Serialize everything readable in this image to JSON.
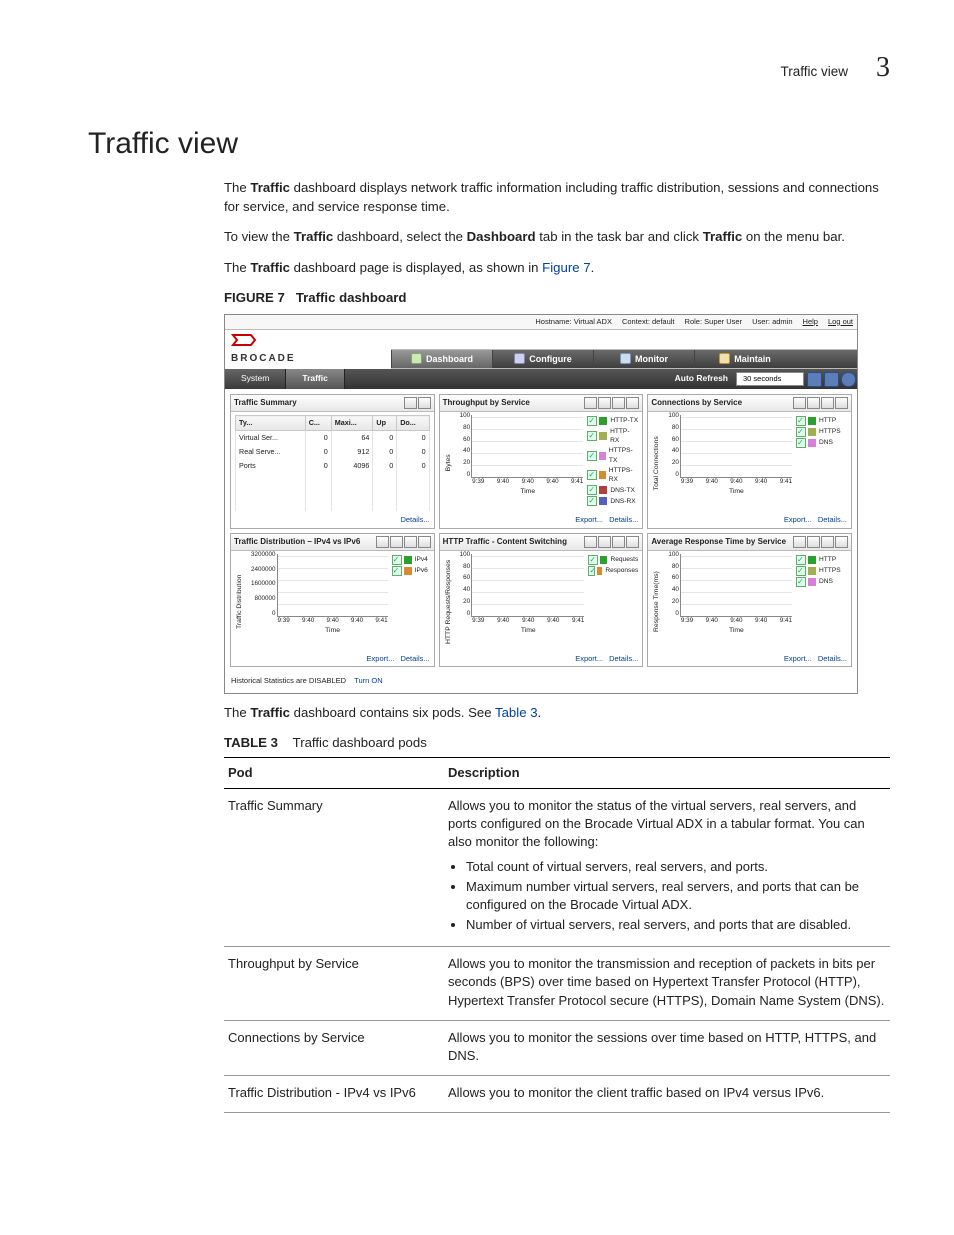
{
  "header": {
    "running_title": "Traffic view",
    "chapter_num": "3"
  },
  "h1": "Traffic view",
  "para1_a": "The ",
  "para1_b": "Traffic",
  "para1_c": " dashboard displays network traffic information including traffic distribution, sessions and connections for service, and service response time.",
  "para2_a": "To view the ",
  "para2_b": "Traffic",
  "para2_c": " dashboard, select the ",
  "para2_d": "Dashboard",
  "para2_e": " tab in the task bar and click ",
  "para2_f": "Traffic",
  "para2_g": " on the menu bar.",
  "para3_a": "The ",
  "para3_b": "Traffic",
  "para3_c": " dashboard page is displayed, as shown in ",
  "para3_link": "Figure 7",
  "para3_d": ".",
  "fig_label": "FIGURE 7",
  "fig_caption": "Traffic dashboard",
  "shot": {
    "topbar": {
      "hostname_l": "Hostname:",
      "hostname_v": "Virtual ADX",
      "context_l": "Context:",
      "context_v": "default",
      "role_l": "Role:",
      "role_v": "Super User",
      "user_l": "User:",
      "user_v": "admin",
      "help": "Help",
      "logout": "Log out"
    },
    "brand": "BROCADE",
    "tabs1": {
      "dashboard": "Dashboard",
      "configure": "Configure",
      "monitor": "Monitor",
      "maintain": "Maintain"
    },
    "tabs2": {
      "system": "System",
      "traffic": "Traffic",
      "auto_refresh": "Auto Refresh",
      "auto_refresh_val": "30 seconds"
    },
    "pod_summary": {
      "title": "Traffic Summary",
      "th": [
        "Ty...",
        "C...",
        "Maxi...",
        "Up",
        "Do..."
      ],
      "rows": [
        [
          "Virtual Ser...",
          "0",
          "64",
          "0",
          "0"
        ],
        [
          "Real Serve...",
          "0",
          "912",
          "0",
          "0"
        ],
        [
          "Ports",
          "0",
          "4096",
          "0",
          "0"
        ]
      ],
      "details": "Details..."
    },
    "pod_throughput": {
      "title": "Throughput by Service",
      "ylabel": "Bytes",
      "yticks": [
        "100",
        "80",
        "60",
        "40",
        "20",
        "0"
      ],
      "xticks": [
        "9:39",
        "9:40",
        "9:40",
        "9:40",
        "9:41"
      ],
      "xlabel": "Time",
      "legend": [
        "HTTP-TX",
        "HTTP-RX",
        "HTTPS-TX",
        "HTTPS-RX",
        "DNS-TX",
        "DNS-RX"
      ],
      "export": "Export...",
      "details": "Details..."
    },
    "pod_conn": {
      "title": "Connections by Service",
      "ylabel": "Total Connections",
      "yticks": [
        "100",
        "80",
        "60",
        "40",
        "20",
        "0"
      ],
      "xticks": [
        "9:39",
        "9:40",
        "9:40",
        "9:40",
        "9:41"
      ],
      "xlabel": "Time",
      "legend": [
        "HTTP",
        "HTTPS",
        "DNS"
      ],
      "export": "Export...",
      "details": "Details..."
    },
    "pod_dist": {
      "title": "Traffic Distribution – IPv4 vs IPv6",
      "ylabel": "Traffic Distribution",
      "yticks": [
        "3200000",
        "2400000",
        "1600000",
        "800000",
        "0"
      ],
      "xticks": [
        "9:39",
        "9:40",
        "9:40",
        "9:40",
        "9:41"
      ],
      "xlabel": "Time",
      "legend": [
        "IPv4",
        "IPv6"
      ],
      "export": "Export...",
      "details": "Details..."
    },
    "pod_http": {
      "title": "HTTP Traffic - Content Switching",
      "ylabel": "HTTP Requests/Responses",
      "yticks": [
        "100",
        "80",
        "60",
        "40",
        "20",
        "0"
      ],
      "xticks": [
        "9:39",
        "9:40",
        "9:40",
        "9:40",
        "9:41"
      ],
      "xlabel": "Time",
      "legend": [
        "Requests",
        "Responses"
      ],
      "export": "Export...",
      "details": "Details..."
    },
    "pod_avg": {
      "title": "Average Response Time by Service",
      "ylabel": "Response Time(ms)",
      "yticks": [
        "100",
        "80",
        "60",
        "40",
        "20",
        "0"
      ],
      "xticks": [
        "9:39",
        "9:40",
        "9:40",
        "9:40",
        "9:41"
      ],
      "xlabel": "Time",
      "legend": [
        "HTTP",
        "HTTPS",
        "DNS"
      ],
      "export": "Export...",
      "details": "Details..."
    },
    "footnote_a": "Historical Statistics are DISABLED",
    "footnote_b": "Turn ON"
  },
  "para4_a": "The ",
  "para4_b": "Traffic",
  "para4_c": " dashboard contains six pods. See ",
  "para4_link": "Table 3",
  "para4_d": ".",
  "tbl_label": "TABLE 3",
  "tbl_caption": "Traffic dashboard pods",
  "tbl_head": {
    "pod": "Pod",
    "desc": "Description"
  },
  "tbl_rows": {
    "r1": {
      "name": "Traffic Summary",
      "p1": "Allows you to monitor the status of the virtual servers, real servers, and ports configured on the Brocade Virtual ADX in a tabular format. You can also monitor the following:",
      "b1": "Total count of virtual servers, real servers, and ports.",
      "b2": "Maximum number virtual servers, real servers, and ports that can be configured on the Brocade Virtual ADX.",
      "b3": "Number of virtual servers, real servers, and ports that are disabled."
    },
    "r2": {
      "name": "Throughput by Service",
      "p1": "Allows you to monitor the transmission and reception of packets in bits per seconds (BPS) over time based on Hypertext Transfer Protocol (HTTP), Hypertext Transfer Protocol secure (HTTPS), Domain Name System (DNS)."
    },
    "r3": {
      "name": "Connections by Service",
      "p1": "Allows you to monitor the sessions over time based on HTTP, HTTPS, and DNS."
    },
    "r4": {
      "name": "Traffic Distribution - IPv4 vs IPv6",
      "p1": "Allows you to monitor the client traffic based on IPv4 versus IPv6."
    }
  },
  "chart_data": [
    {
      "type": "line",
      "title": "Throughput by Service",
      "xlabel": "Time",
      "ylabel": "Bytes",
      "ylim": [
        0,
        100
      ],
      "x": [
        "9:39",
        "9:40",
        "9:40",
        "9:40",
        "9:41"
      ],
      "series": [
        {
          "name": "HTTP-TX",
          "values": [
            0,
            0,
            0,
            0,
            0
          ]
        },
        {
          "name": "HTTP-RX",
          "values": [
            0,
            0,
            0,
            0,
            0
          ]
        },
        {
          "name": "HTTPS-TX",
          "values": [
            0,
            0,
            0,
            0,
            0
          ]
        },
        {
          "name": "HTTPS-RX",
          "values": [
            0,
            0,
            0,
            0,
            0
          ]
        },
        {
          "name": "DNS-TX",
          "values": [
            0,
            0,
            0,
            0,
            0
          ]
        },
        {
          "name": "DNS-RX",
          "values": [
            0,
            0,
            0,
            0,
            0
          ]
        }
      ]
    },
    {
      "type": "line",
      "title": "Connections by Service",
      "xlabel": "Time",
      "ylabel": "Total Connections",
      "ylim": [
        0,
        100
      ],
      "x": [
        "9:39",
        "9:40",
        "9:40",
        "9:40",
        "9:41"
      ],
      "series": [
        {
          "name": "HTTP",
          "values": [
            0,
            0,
            0,
            0,
            0
          ]
        },
        {
          "name": "HTTPS",
          "values": [
            0,
            0,
            0,
            0,
            0
          ]
        },
        {
          "name": "DNS",
          "values": [
            0,
            0,
            0,
            0,
            0
          ]
        }
      ]
    },
    {
      "type": "line",
      "title": "Traffic Distribution – IPv4 vs IPv6",
      "xlabel": "Time",
      "ylabel": "Traffic Distribution",
      "ylim": [
        0,
        3200000
      ],
      "x": [
        "9:39",
        "9:40",
        "9:40",
        "9:40",
        "9:41"
      ],
      "series": [
        {
          "name": "IPv4",
          "values": [
            0,
            0,
            0,
            0,
            0
          ]
        },
        {
          "name": "IPv6",
          "values": [
            0,
            0,
            0,
            0,
            0
          ]
        }
      ]
    },
    {
      "type": "line",
      "title": "HTTP Traffic - Content Switching",
      "xlabel": "Time",
      "ylabel": "HTTP Requests/Responses",
      "ylim": [
        0,
        100
      ],
      "x": [
        "9:39",
        "9:40",
        "9:40",
        "9:40",
        "9:41"
      ],
      "series": [
        {
          "name": "Requests",
          "values": [
            0,
            0,
            0,
            0,
            0
          ]
        },
        {
          "name": "Responses",
          "values": [
            0,
            0,
            0,
            0,
            0
          ]
        }
      ]
    },
    {
      "type": "line",
      "title": "Average Response Time by Service",
      "xlabel": "Time",
      "ylabel": "Response Time(ms)",
      "ylim": [
        0,
        100
      ],
      "x": [
        "9:39",
        "9:40",
        "9:40",
        "9:40",
        "9:41"
      ],
      "series": [
        {
          "name": "HTTP",
          "values": [
            0,
            0,
            0,
            0,
            0
          ]
        },
        {
          "name": "HTTPS",
          "values": [
            0,
            0,
            0,
            0,
            0
          ]
        },
        {
          "name": "DNS",
          "values": [
            0,
            0,
            0,
            0,
            0
          ]
        }
      ]
    },
    {
      "type": "table",
      "title": "Traffic Summary",
      "columns": [
        "Type",
        "Count",
        "Maximum",
        "Up",
        "Down"
      ],
      "rows": [
        [
          "Virtual Servers",
          0,
          64,
          0,
          0
        ],
        [
          "Real Servers",
          0,
          912,
          0,
          0
        ],
        [
          "Ports",
          0,
          4096,
          0,
          0
        ]
      ]
    }
  ]
}
